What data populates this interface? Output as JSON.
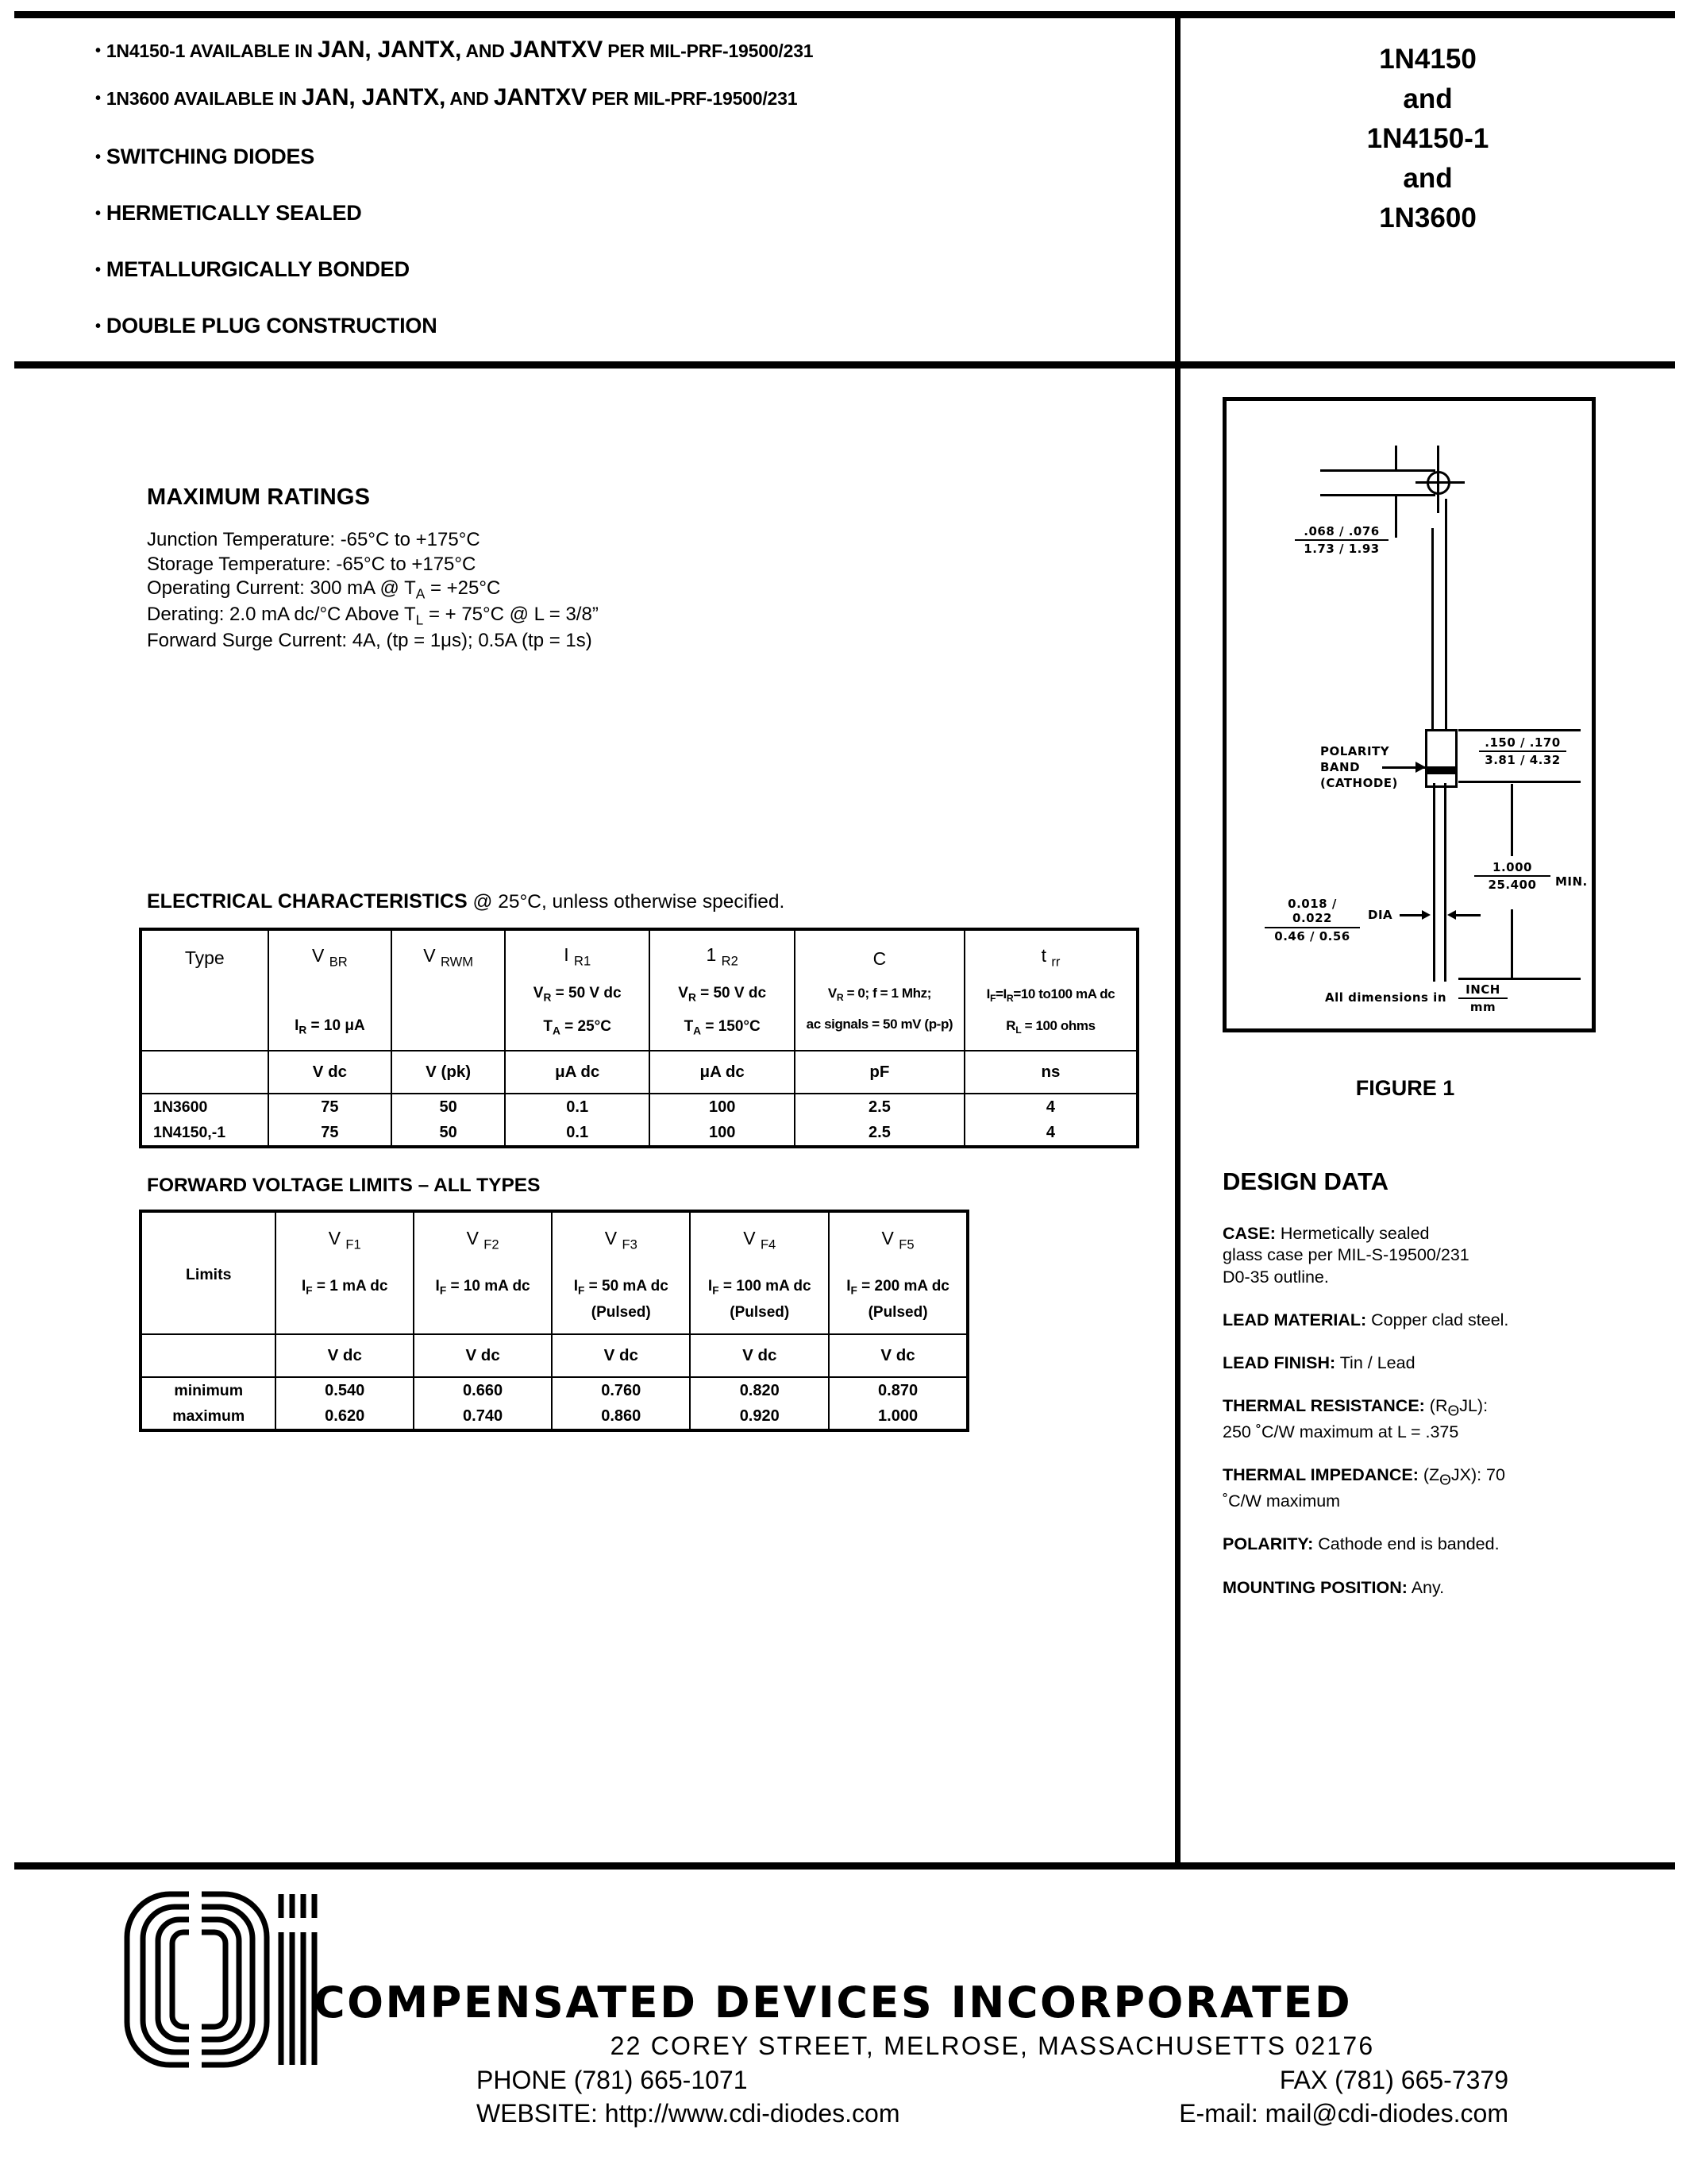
{
  "header": {
    "features": [
      {
        "pre": "1N4150-1 AVAILABLE IN ",
        "big": "JAN, JANTX,",
        "mid": " AND ",
        "big2": "JANTXV",
        "post": " PER MIL-PRF-19500/231"
      },
      {
        "pre": "1N3600 AVAILABLE IN ",
        "big": "JAN,  JANTX,",
        "mid": " AND ",
        "big2": "JANTXV",
        "post": " PER MIL-PRF-19500/231"
      }
    ],
    "features_plain": [
      "SWITCHING DIODES",
      "HERMETICALLY SEALED",
      "METALLURGICALLY BONDED",
      "DOUBLE PLUG CONSTRUCTION"
    ],
    "part_title_lines": [
      "1N4150",
      "and",
      "1N4150-1",
      "and",
      "1N3600"
    ]
  },
  "max_ratings": {
    "title": "MAXIMUM RATINGS",
    "lines": [
      {
        "label": "Junction Temperature: ",
        "value": "-65°C to +175°C"
      },
      {
        "label": "Storage Temperature: ",
        "value": "-65°C to +175°C"
      },
      {
        "label": "Operating Current: 300 mA @ T",
        "sub": "A",
        "value": " = +25°C"
      },
      {
        "label": "Derating: 2.0 mA dc/°C Above T",
        "sub": "L",
        "value": " = + 75°C @ L = 3/8”"
      },
      {
        "label": "Forward Surge Current: 4A, (tp = 1μs); 0.5A (tp = 1s)",
        "value": ""
      }
    ]
  },
  "electrical": {
    "title_bold": "ELECTRICAL CHARACTERISTICS",
    "title_rest": " @ 25°C, unless otherwise specified.",
    "columns": [
      {
        "symbol": "Type",
        "sub": "",
        "cond1": "",
        "cond2": "",
        "unit": ""
      },
      {
        "symbol": "V",
        "sub": "BR",
        "cond1": "",
        "cond2": "I<sub>R</sub> = 10 μA",
        "unit": "V dc"
      },
      {
        "symbol": "V",
        "sub": "RWM",
        "cond1": "",
        "cond2": "",
        "unit": "V (pk)"
      },
      {
        "symbol": "I",
        "sub": "R1",
        "cond1": "V<sub>R</sub> = 50 V dc",
        "cond2": "T<sub>A</sub> = 25°C",
        "unit": "μA  dc"
      },
      {
        "symbol": "1",
        "sub": "R2",
        "cond1": "V<sub>R</sub> = 50 V dc",
        "cond2": "T<sub>A</sub> = 150°C",
        "unit": "μA dc"
      },
      {
        "symbol": "C",
        "sub": "",
        "cond1": "V<sub>R</sub> = 0; f = 1 Mhz;",
        "cond2": "ac signals = 50 mV (p-p)",
        "unit": "pF"
      },
      {
        "symbol": "t",
        "sub": "rr",
        "cond1": "I<sub>F</sub>=I<sub>R</sub>=10 to100 mA dc",
        "cond2": "R<sub>L</sub> = 100 ohms",
        "unit": "ns"
      }
    ],
    "rows": [
      {
        "type": "1N3600",
        "values": [
          "75",
          "50",
          "0.1",
          "100",
          "2.5",
          "4"
        ]
      },
      {
        "type": "1N4150,-1",
        "values": [
          "75",
          "50",
          "0.1",
          "100",
          "2.5",
          "4"
        ]
      }
    ]
  },
  "forward_voltage": {
    "title": "FORWARD VOLTAGE LIMITS – ALL TYPES",
    "row_header": "Limits",
    "columns": [
      {
        "symbol": "V",
        "sub": "F1",
        "cond": "I<sub>F</sub> = 1 mA dc",
        "pulsed": "",
        "unit": "V dc"
      },
      {
        "symbol": "V",
        "sub": "F2",
        "cond": "I<sub>F</sub> = 10 mA dc",
        "pulsed": "",
        "unit": "V dc"
      },
      {
        "symbol": "V",
        "sub": "F3",
        "cond": "I<sub>F</sub> = 50 mA dc",
        "pulsed": "(Pulsed)",
        "unit": "V dc"
      },
      {
        "symbol": "V",
        "sub": "F4",
        "cond": "I<sub>F</sub> = 100 mA dc",
        "pulsed": "(Pulsed)",
        "unit": "V dc"
      },
      {
        "symbol": "V",
        "sub": "F5",
        "cond": "I<sub>F</sub> = 200 mA dc",
        "pulsed": "(Pulsed)",
        "unit": "V dc"
      }
    ],
    "rows": [
      {
        "label": "minimum",
        "values": [
          "0.540",
          "0.660",
          "0.760",
          "0.820",
          "0.870"
        ]
      },
      {
        "label": "maximum",
        "values": [
          "0.620",
          "0.740",
          "0.860",
          "0.920",
          "1.000"
        ]
      }
    ]
  },
  "figure": {
    "caption": "FIGURE 1",
    "dim_body_dia_in": ".068 / .076",
    "dim_body_dia_mm": "1.73 / 1.93",
    "dim_body_len_in": ".150 / .170",
    "dim_body_len_mm": "3.81 / 4.32",
    "dim_lead_len_in": "1.000",
    "dim_lead_len_mm": "25.400",
    "dim_lead_len_note": "MIN.",
    "dim_lead_dia_in": "0.018 / 0.022",
    "dim_lead_dia_mm": "0.46 / 0.56",
    "dim_lead_dia_note": "DIA",
    "polarity_label_l1": "POLARITY",
    "polarity_label_l2": "BAND",
    "polarity_label_l3": "(CATHODE)",
    "units_note": "All dimensions in",
    "units_in": "INCH",
    "units_mm": "mm"
  },
  "design_data": {
    "title": "DESIGN DATA",
    "items": [
      {
        "label": "CASE:",
        "text": " Hermetically sealed<br>glass case per MIL-S-19500/231<br>D0-35 outline."
      },
      {
        "label": "LEAD MATERIAL:",
        "text": " Copper clad steel."
      },
      {
        "label": "LEAD FINISH:",
        "text": " Tin / Lead"
      },
      {
        "label": "THERMAL RESISTANCE:",
        "text": "  (R<span class='theta'>Θ</span>JL):<br>250 ˚C/W maximum at L = .375"
      },
      {
        "label": "THERMAL IMPEDANCE:",
        "text": " (Z<span class='theta'>Θ</span>JX):   70<br>˚C/W maximum"
      },
      {
        "label": "POLARITY:",
        "text": " Cathode end is banded."
      },
      {
        "label": "MOUNTING POSITION:",
        "text": " Any."
      }
    ]
  },
  "footer": {
    "company": "COMPENSATED DEVICES INCORPORATED",
    "address": "22 COREY STREET, MELROSE, MASSACHUSETTS 02176",
    "phone": "PHONE (781) 665-1071",
    "fax": "FAX (781) 665-7379",
    "website": "WEBSITE:  http://www.cdi-diodes.com",
    "email": "E-mail: mail@cdi-diodes.com"
  },
  "colors": {
    "ink": "#000000",
    "paper": "#ffffff"
  }
}
